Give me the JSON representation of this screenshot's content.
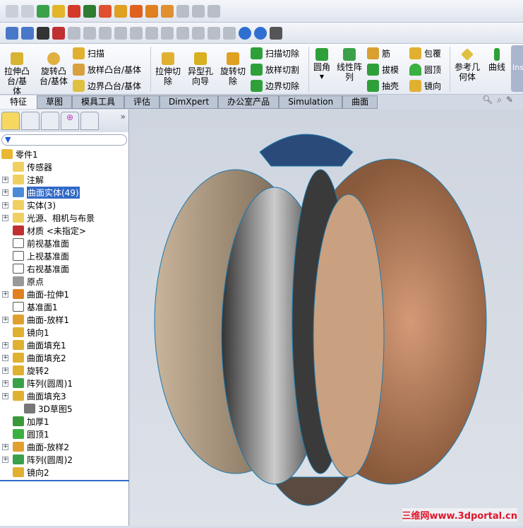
{
  "ribbon": {
    "extrude_boss": "拉伸凸台/基体",
    "revolve_boss": "旋转凸台/基体",
    "sweep": "扫描",
    "loft": "放样凸台/基体",
    "boundary": "边界凸台/基体",
    "extrude_cut": "拉伸切除",
    "hole_wizard": "异型孔向导",
    "revolve_cut": "旋转切除",
    "swept_cut": "扫描切除",
    "lofted_cut": "放样切割",
    "boundary_cut": "边界切除",
    "fillet": "圆角",
    "linear_pattern": "线性阵列",
    "rib": "筋",
    "draft": "拔模",
    "shell": "抽壳",
    "wrap": "包覆",
    "dome": "圆顶",
    "mirror": "镜向",
    "ref_geometry": "参考几何体",
    "curves": "曲线",
    "instant3d": "Ins"
  },
  "tabs": [
    "特征",
    "草图",
    "模具工具",
    "评估",
    "DimXpert",
    "办公室产品",
    "Simulation",
    "曲面"
  ],
  "tree": [
    {
      "label": "零件1",
      "exp": false,
      "indent": 0
    },
    {
      "label": "传感器",
      "exp": false,
      "indent": 1
    },
    {
      "label": "注解",
      "exp": true,
      "indent": 1
    },
    {
      "label": "曲面实体(49)",
      "exp": true,
      "indent": 1,
      "selected": true
    },
    {
      "label": "实体(3)",
      "exp": true,
      "indent": 1
    },
    {
      "label": "光源、相机与布景",
      "exp": true,
      "indent": 1
    },
    {
      "label": "材质 <未指定>",
      "exp": false,
      "indent": 1
    },
    {
      "label": "前视基准面",
      "exp": false,
      "indent": 1
    },
    {
      "label": "上视基准面",
      "exp": false,
      "indent": 1
    },
    {
      "label": "右视基准面",
      "exp": false,
      "indent": 1
    },
    {
      "label": "原点",
      "exp": false,
      "indent": 1
    },
    {
      "label": "曲面-拉伸1",
      "exp": true,
      "indent": 1
    },
    {
      "label": "基准面1",
      "exp": false,
      "indent": 1
    },
    {
      "label": "曲面-放样1",
      "exp": true,
      "indent": 1
    },
    {
      "label": "镜向1",
      "exp": false,
      "indent": 1
    },
    {
      "label": "曲面填充1",
      "exp": true,
      "indent": 1
    },
    {
      "label": "曲面填充2",
      "exp": true,
      "indent": 1
    },
    {
      "label": "旋转2",
      "exp": true,
      "indent": 1
    },
    {
      "label": "阵列(圆周)1",
      "exp": true,
      "indent": 1
    },
    {
      "label": "曲面填充3",
      "exp": true,
      "indent": 1
    },
    {
      "label": "3D草图5",
      "exp": false,
      "indent": 2
    },
    {
      "label": "加厚1",
      "exp": false,
      "indent": 1
    },
    {
      "label": "圆顶1",
      "exp": false,
      "indent": 1
    },
    {
      "label": "曲面-放样2",
      "exp": true,
      "indent": 1
    },
    {
      "label": "阵列(圆周)2",
      "exp": true,
      "indent": 1
    },
    {
      "label": "镜向2",
      "exp": false,
      "indent": 1
    }
  ],
  "filter_icon": "funnel-icon",
  "watermark": "三维网www.3dportal.cn"
}
